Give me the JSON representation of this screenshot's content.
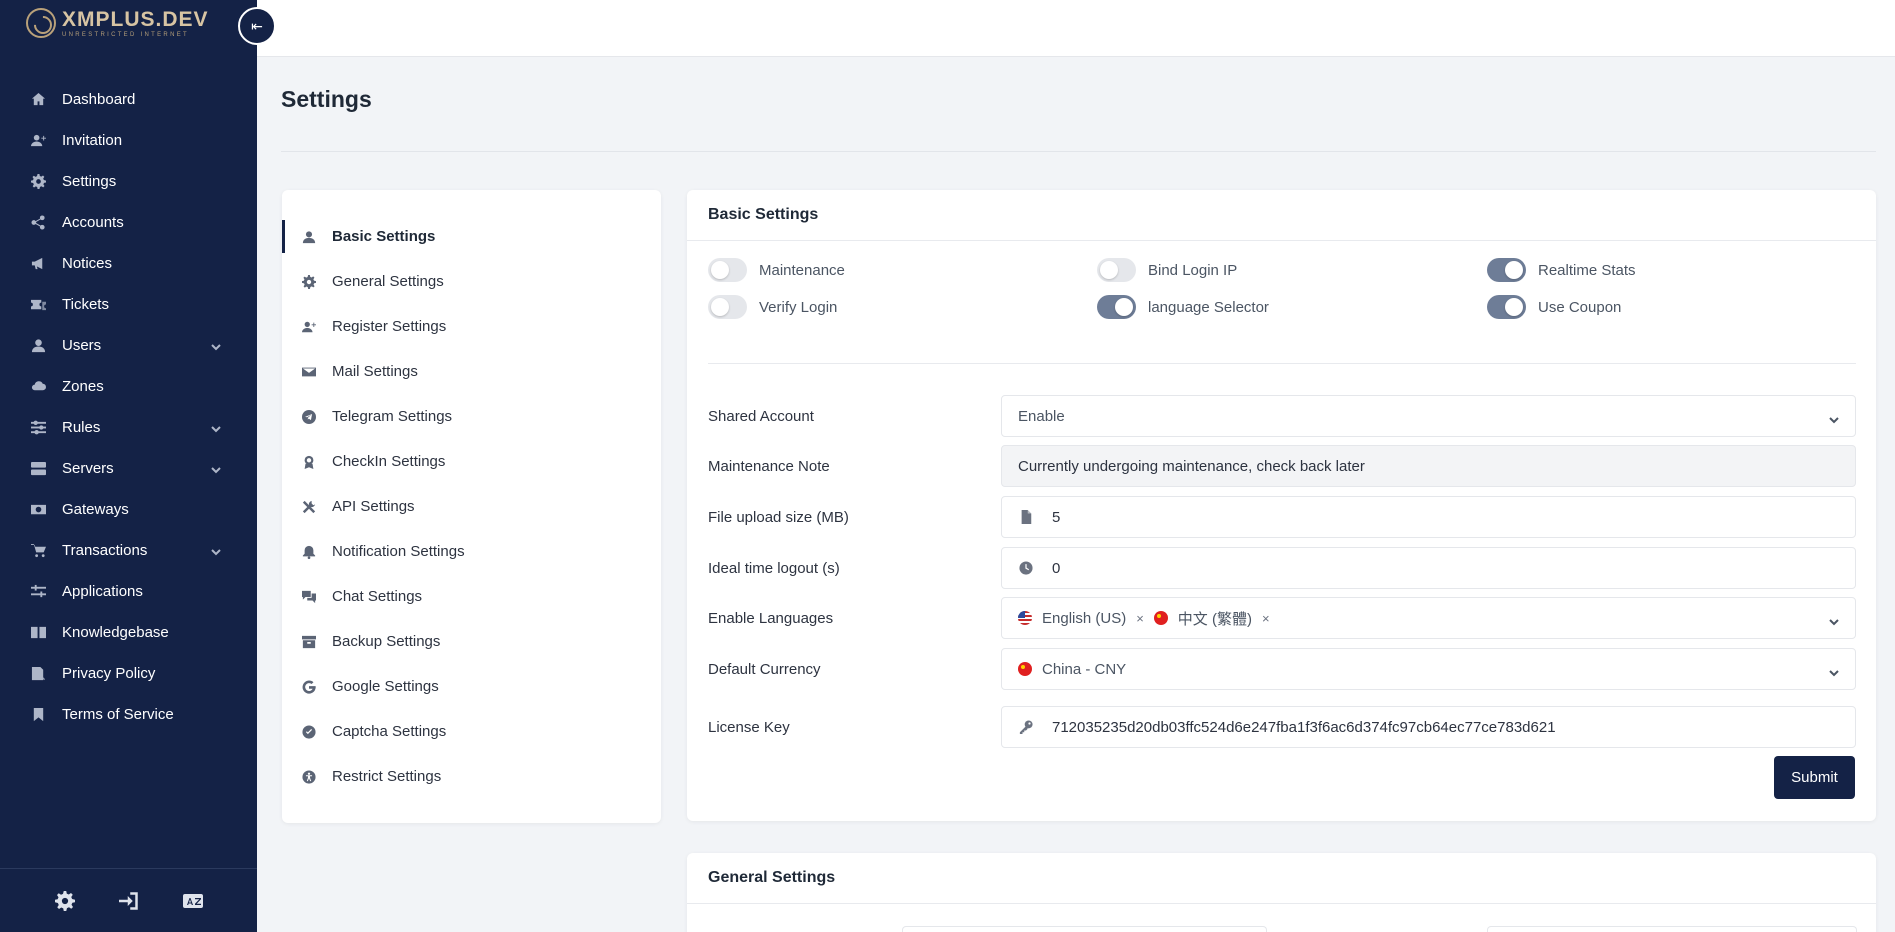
{
  "brand": {
    "title": "XMPLUS.DEV",
    "subtitle": "UNRESTRICTED INTERNET"
  },
  "sidebar": {
    "collapse_icon": "collapse-left-icon",
    "items": [
      {
        "label": "Dashboard",
        "icon": "home-icon",
        "has_children": false
      },
      {
        "label": "Invitation",
        "icon": "user-plus-icon",
        "has_children": false
      },
      {
        "label": "Settings",
        "icon": "gear-icon",
        "has_children": false
      },
      {
        "label": "Accounts",
        "icon": "share-icon",
        "has_children": false
      },
      {
        "label": "Notices",
        "icon": "megaphone-icon",
        "has_children": false
      },
      {
        "label": "Tickets",
        "icon": "tickets-icon",
        "has_children": false
      },
      {
        "label": "Users",
        "icon": "user-icon",
        "has_children": true
      },
      {
        "label": "Zones",
        "icon": "cloud-icon",
        "has_children": false
      },
      {
        "label": "Rules",
        "icon": "sliders-icon",
        "has_children": true
      },
      {
        "label": "Servers",
        "icon": "server-icon",
        "has_children": true
      },
      {
        "label": "Gateways",
        "icon": "money-icon",
        "has_children": false
      },
      {
        "label": "Transactions",
        "icon": "cart-icon",
        "has_children": true
      },
      {
        "label": "Applications",
        "icon": "apps-icon",
        "has_children": false
      },
      {
        "label": "Knowledgebase",
        "icon": "book-icon",
        "has_children": false
      },
      {
        "label": "Privacy Policy",
        "icon": "policy-icon",
        "has_children": false
      },
      {
        "label": "Terms of Service",
        "icon": "bookmark-icon",
        "has_children": false
      }
    ],
    "footer_icons": [
      "theme-gear-icon",
      "sign-in-icon",
      "language-icon"
    ]
  },
  "page": {
    "title": "Settings"
  },
  "settings_menu": {
    "items": [
      {
        "label": "Basic Settings",
        "icon": "user-icon",
        "active": true
      },
      {
        "label": "General Settings",
        "icon": "gear-icon",
        "active": false
      },
      {
        "label": "Register Settings",
        "icon": "user-plus-icon",
        "active": false
      },
      {
        "label": "Mail Settings",
        "icon": "mail-icon",
        "active": false
      },
      {
        "label": "Telegram Settings",
        "icon": "telegram-icon",
        "active": false
      },
      {
        "label": "CheckIn Settings",
        "icon": "award-icon",
        "active": false
      },
      {
        "label": "API Settings",
        "icon": "tools-icon",
        "active": false
      },
      {
        "label": "Notification Settings",
        "icon": "bell-icon",
        "active": false
      },
      {
        "label": "Chat Settings",
        "icon": "chat-icon",
        "active": false
      },
      {
        "label": "Backup Settings",
        "icon": "archive-icon",
        "active": false
      },
      {
        "label": "Google Settings",
        "icon": "google-icon",
        "active": false
      },
      {
        "label": "Captcha Settings",
        "icon": "check-badge-icon",
        "active": false
      },
      {
        "label": "Restrict Settings",
        "icon": "accessibility-icon",
        "active": false
      }
    ]
  },
  "basic_settings": {
    "header": "Basic Settings",
    "toggles": [
      {
        "label": "Maintenance",
        "on": false
      },
      {
        "label": "Bind Login IP",
        "on": false
      },
      {
        "label": "Realtime Stats",
        "on": true
      },
      {
        "label": "Verify Login",
        "on": false
      },
      {
        "label": "language Selector",
        "on": true
      },
      {
        "label": "Use Coupon",
        "on": true
      }
    ],
    "fields": {
      "shared_account": {
        "label": "Shared Account",
        "value": "Enable"
      },
      "maintenance_note": {
        "label": "Maintenance Note",
        "value": "Currently undergoing maintenance, check back later"
      },
      "file_upload_size": {
        "label": "File upload size (MB)",
        "value": "5",
        "icon": "file-icon"
      },
      "idle_logout": {
        "label": "Ideal time logout (s)",
        "value": "0",
        "icon": "clock-icon"
      },
      "languages": {
        "label": "Enable Languages",
        "chips": [
          {
            "label": "English (US)",
            "flag": "us-flag-icon"
          },
          {
            "label": "中文 (繁體)",
            "flag": "cn-flag-icon"
          }
        ],
        "remove_glyph": "×"
      },
      "default_currency": {
        "label": "Default Currency",
        "value": "China - CNY",
        "flag": "cn-flag-icon"
      },
      "license_key": {
        "label": "License Key",
        "value": "712035235d20db03ffc524d6e247fba1f3f6ac6d374fc97cb64ec77ce783d621",
        "icon": "key-icon"
      }
    },
    "submit_label": "Submit"
  },
  "general_settings": {
    "header": "General Settings"
  },
  "colors": {
    "sidebar_bg": "#142246",
    "accent": "#142246",
    "toggle_on": "#6e7d97",
    "brand_gold": "#d7c4a3"
  }
}
